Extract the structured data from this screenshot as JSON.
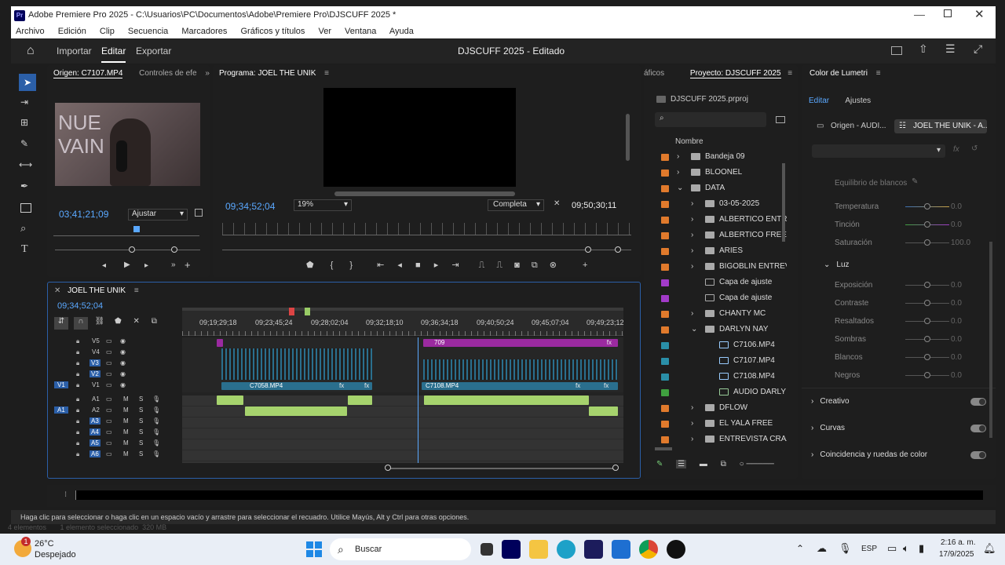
{
  "window": {
    "title": "Adobe Premiere Pro 2025 - C:\\Usuarios\\PC\\Documentos\\Adobe\\Premiere Pro\\DJSCUFF 2025 *",
    "app_badge": "Pr"
  },
  "menu": [
    "Archivo",
    "Edición",
    "Clip",
    "Secuencia",
    "Marcadores",
    "Gráficos y títulos",
    "Ver",
    "Ventana",
    "Ayuda"
  ],
  "workspace": {
    "tabs": [
      "Importar",
      "Editar",
      "Exportar"
    ],
    "active": "Editar",
    "project_title": "DJSCUFF 2025 - Editado"
  },
  "source": {
    "tab": "Origen: C7107.MP4",
    "tab2": "Controles de efe",
    "overlay_line1": "NUE",
    "overlay_line2": "VAIN",
    "timecode": "03;41;21;09",
    "fit": "Ajustar"
  },
  "program": {
    "tab": "Programa: JOEL THE UNIK",
    "timecode": "09;34;52;04",
    "zoom": "19%",
    "quality": "Completa",
    "duration": "09;50;30;11"
  },
  "timeline": {
    "tab": "JOEL THE UNIK",
    "timecode": "09;34;52;04",
    "ruler": [
      "09;19;29;18",
      "09;23;45;24",
      "09;28;02;04",
      "09;32;18;10",
      "09;36;34;18",
      "09;40;50;24",
      "09;45;07;04",
      "09;49;23;12"
    ],
    "video_tracks": [
      {
        "name": "V5"
      },
      {
        "name": "V4"
      },
      {
        "name": "V3"
      },
      {
        "name": "V2"
      },
      {
        "name": "V1",
        "target": "V1"
      }
    ],
    "audio_tracks": [
      {
        "name": "A1",
        "target": "A1"
      },
      {
        "name": "A2"
      },
      {
        "name": "A3"
      },
      {
        "name": "A4"
      },
      {
        "name": "A5"
      },
      {
        "name": "A6"
      }
    ],
    "mute": "M",
    "solo": "S",
    "clip_709": "709",
    "clip_c7058": "C7058.MP4",
    "clip_c7108": "C7108.MP4",
    "fx": "fx"
  },
  "project": {
    "tab_prev": "áficos",
    "tab": "Proyecto: DJSCUFF 2025",
    "file": "DJSCUFF 2025.prproj",
    "column": "Nombre",
    "items": [
      {
        "name": "Bandeja 09",
        "color": "#e07a2c",
        "type": "folder",
        "indent": 0,
        "exp": "closed"
      },
      {
        "name": "BLOONEL",
        "color": "#e07a2c",
        "type": "folder",
        "indent": 0,
        "exp": "closed"
      },
      {
        "name": "DATA",
        "color": "#e07a2c",
        "type": "folder",
        "indent": 0,
        "exp": "open"
      },
      {
        "name": "03-05-2025",
        "color": "#e07a2c",
        "type": "folder",
        "indent": 1,
        "exp": "closed"
      },
      {
        "name": "ALBERTICO ENTRE",
        "color": "#e07a2c",
        "type": "folder",
        "indent": 1,
        "exp": "closed"
      },
      {
        "name": "ALBERTICO FREE",
        "color": "#e07a2c",
        "type": "folder",
        "indent": 1,
        "exp": "closed"
      },
      {
        "name": "ARIES",
        "color": "#e07a2c",
        "type": "folder",
        "indent": 1,
        "exp": "closed"
      },
      {
        "name": "BIGOBLIN ENTREV",
        "color": "#e07a2c",
        "type": "folder",
        "indent": 1,
        "exp": "closed"
      },
      {
        "name": "Capa de ajuste",
        "color": "#a23bc9",
        "type": "file",
        "indent": 1,
        "exp": "none"
      },
      {
        "name": "Capa de ajuste",
        "color": "#a23bc9",
        "type": "file",
        "indent": 1,
        "exp": "none"
      },
      {
        "name": "CHANTY MC",
        "color": "#e07a2c",
        "type": "folder",
        "indent": 1,
        "exp": "closed"
      },
      {
        "name": "DARLYN NAY",
        "color": "#e07a2c",
        "type": "folder",
        "indent": 1,
        "exp": "open"
      },
      {
        "name": "C7106.MP4",
        "color": "#2a8fa8",
        "type": "clip",
        "indent": 2,
        "exp": "none"
      },
      {
        "name": "C7107.MP4",
        "color": "#2a8fa8",
        "type": "clip",
        "indent": 2,
        "exp": "none"
      },
      {
        "name": "C7108.MP4",
        "color": "#2a8fa8",
        "type": "clip",
        "indent": 2,
        "exp": "none"
      },
      {
        "name": "AUDIO DARLY",
        "color": "#3fa03f",
        "type": "audio",
        "indent": 2,
        "exp": "none"
      },
      {
        "name": "DFLOW",
        "color": "#e07a2c",
        "type": "folder",
        "indent": 1,
        "exp": "closed"
      },
      {
        "name": "EL YALA FREE",
        "color": "#e07a2c",
        "type": "folder",
        "indent": 1,
        "exp": "closed"
      },
      {
        "name": "ENTREVISTA CRAZ",
        "color": "#e07a2c",
        "type": "folder",
        "indent": 1,
        "exp": "closed"
      }
    ]
  },
  "lumetri": {
    "title": "Color de Lumetri",
    "tabs": [
      "Editar",
      "Ajustes"
    ],
    "source_tab": "Origen - AUDI...",
    "seq_tab": "JOEL THE UNIK - A...",
    "wb_label": "Equilibrio de blancos",
    "wb": [
      {
        "label": "Temperatura",
        "value": "0.0"
      },
      {
        "label": "Tinción",
        "value": "0.0"
      },
      {
        "label": "Saturación",
        "value": "100.0"
      }
    ],
    "light_label": "Luz",
    "light": [
      {
        "label": "Exposición",
        "value": "0.0"
      },
      {
        "label": "Contraste",
        "value": "0.0"
      },
      {
        "label": "Resaltados",
        "value": "0.0"
      },
      {
        "label": "Sombras",
        "value": "0.0"
      },
      {
        "label": "Blancos",
        "value": "0.0"
      },
      {
        "label": "Negros",
        "value": "0.0"
      }
    ],
    "sections": [
      "Creativo",
      "Curvas",
      "Coincidencia y ruedas de color"
    ]
  },
  "status": {
    "text": "Haga clic para seleccionar o haga clic en un espacio vacío y arrastre para seleccionar el recuadro. Utilice Mayús, Alt y Ctrl para otras opciones.",
    "bottom": "4 elementos       1 elemento seleccionado  320 MB"
  },
  "taskbar": {
    "temp": "26°C",
    "weather": "Despejado",
    "badge": "1",
    "search": "Buscar",
    "lang": "ESP",
    "time": "2:16 a. m.",
    "date": "17/9/2025"
  },
  "colors": {
    "accent": "#5aa8ff",
    "video_clip": "#2a6f8e",
    "audio_clip": "#a6d36d",
    "purple_clip": "#9b2aa0",
    "playhead": "#5aa8ff"
  }
}
